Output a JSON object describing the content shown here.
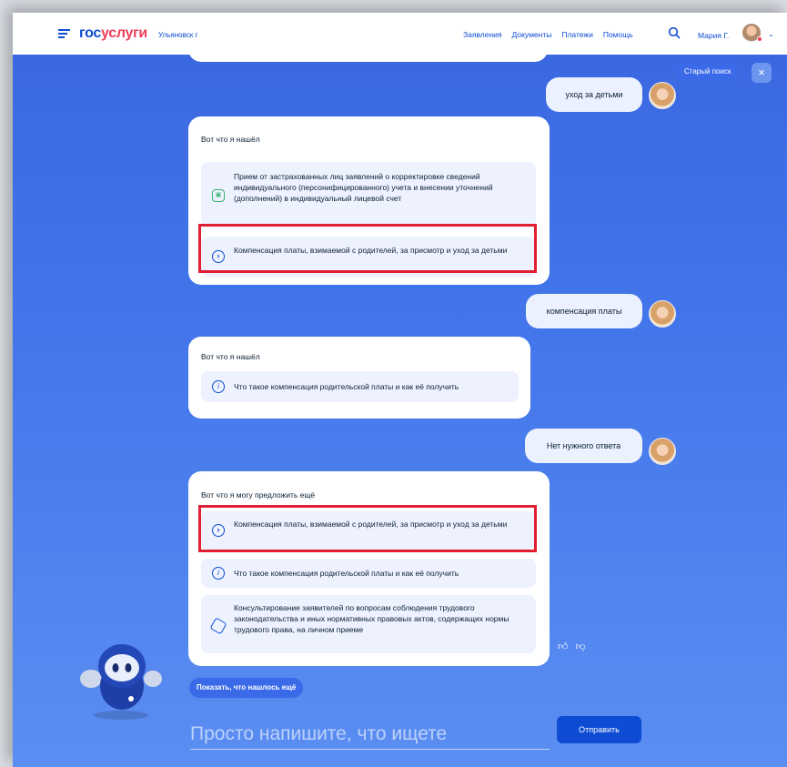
{
  "header": {
    "logo_gos": "гос",
    "logo_usl": "услуги",
    "city": "Ульяновск г",
    "nav": [
      "Заявления",
      "Документы",
      "Платежи",
      "Помощь"
    ],
    "user_name": "Мария Г."
  },
  "controls": {
    "old_search": "Старый поиск",
    "close": "×"
  },
  "messages": {
    "user1": "уход за детьми",
    "bot1": {
      "intro": "Вот что я нашёл",
      "card1": "Прием от застрахованных лиц заявлений о корректировке сведений индивидуального (персонифицированного) учета и внесении уточнений (дополнений) в индивидуальный лицевой счет",
      "card2": "Компенсация платы, взимаемой с родителей, за присмотр и уход за детьми"
    },
    "user2": "компенсация платы",
    "bot2": {
      "intro": "Вот что я нашёл",
      "card1": "Что такое компенсация родительской платы и как её получить"
    },
    "user3": "Нет нужного ответа",
    "bot3": {
      "intro": "Вот что я могу предложить ещё",
      "card1": "Компенсация платы, взимаемой с родителей, за присмотр и уход за детьми",
      "card2": "Что такое компенсация родительской платы и как её получить",
      "card3": "Консультирование заявителей по вопросам соблюдения трудового законодательства и иных нормативных правовых актов, содержащих нормы трудового права, на личном приеме"
    }
  },
  "composer": {
    "more_label": "Показать, что нашлось ещё",
    "placeholder": "Просто напишите, что ищете",
    "send_label": "Отправить"
  },
  "icons": [
    "menu-icon",
    "search-icon",
    "chevron-down-icon",
    "close-icon",
    "arrow-right-circle-icon",
    "info-icon",
    "service-icon",
    "hexagon-icon",
    "thumbs-up-icon",
    "thumbs-down-icon"
  ]
}
